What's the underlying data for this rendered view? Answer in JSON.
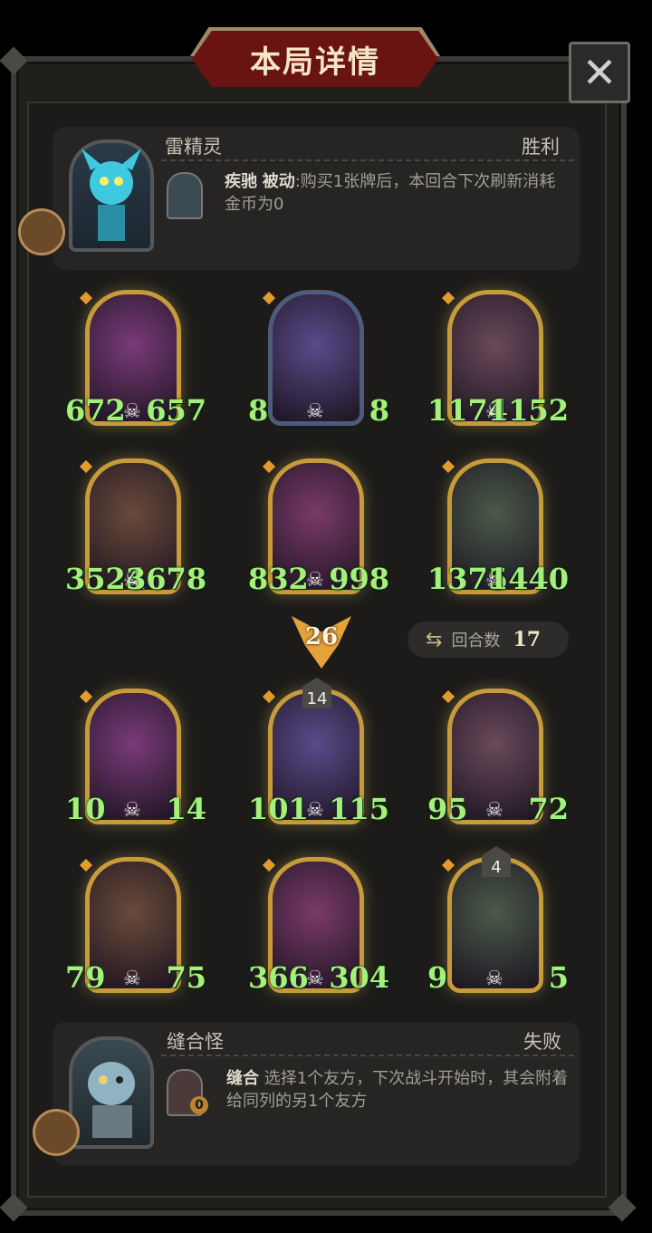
{
  "title": "本局详情",
  "close_icon": "close-icon",
  "colors": {
    "stat_green": "#a5f07a",
    "title_red": "#6a1313",
    "gold_border": "#c79b3a"
  },
  "player_top": {
    "name": "雷精灵",
    "result": "胜利",
    "skill_name": "疾驰",
    "skill_type": "被动",
    "skill_desc": ":购买1张牌后，本回合下次刷新消耗金币为0"
  },
  "enemy_board": [
    {
      "atk": "672",
      "hp": "657"
    },
    {
      "atk": "8",
      "hp": "8"
    },
    {
      "atk": "1174",
      "hp": "1152"
    },
    {
      "atk": "3524",
      "hp": "3678"
    },
    {
      "atk": "832",
      "hp": "998"
    },
    {
      "atk": "1375",
      "hp": "1440"
    }
  ],
  "tier": "26",
  "rounds": {
    "label": "回合数",
    "value": "17"
  },
  "player_board": [
    {
      "atk": "10",
      "hp": "14"
    },
    {
      "atk": "101",
      "hp": "115",
      "badge": "14"
    },
    {
      "atk": "95",
      "hp": "72"
    },
    {
      "atk": "79",
      "hp": "75"
    },
    {
      "atk": "366",
      "hp": "304"
    },
    {
      "atk": "9",
      "hp": "5",
      "badge": "4"
    }
  ],
  "player_bottom": {
    "name": "缝合怪",
    "result": "失败",
    "skill_name": "缝合",
    "skill_desc": " 选择1个友方，下次战斗开始时，其会附着给同列的另1个友方",
    "skill_badge": "0"
  }
}
